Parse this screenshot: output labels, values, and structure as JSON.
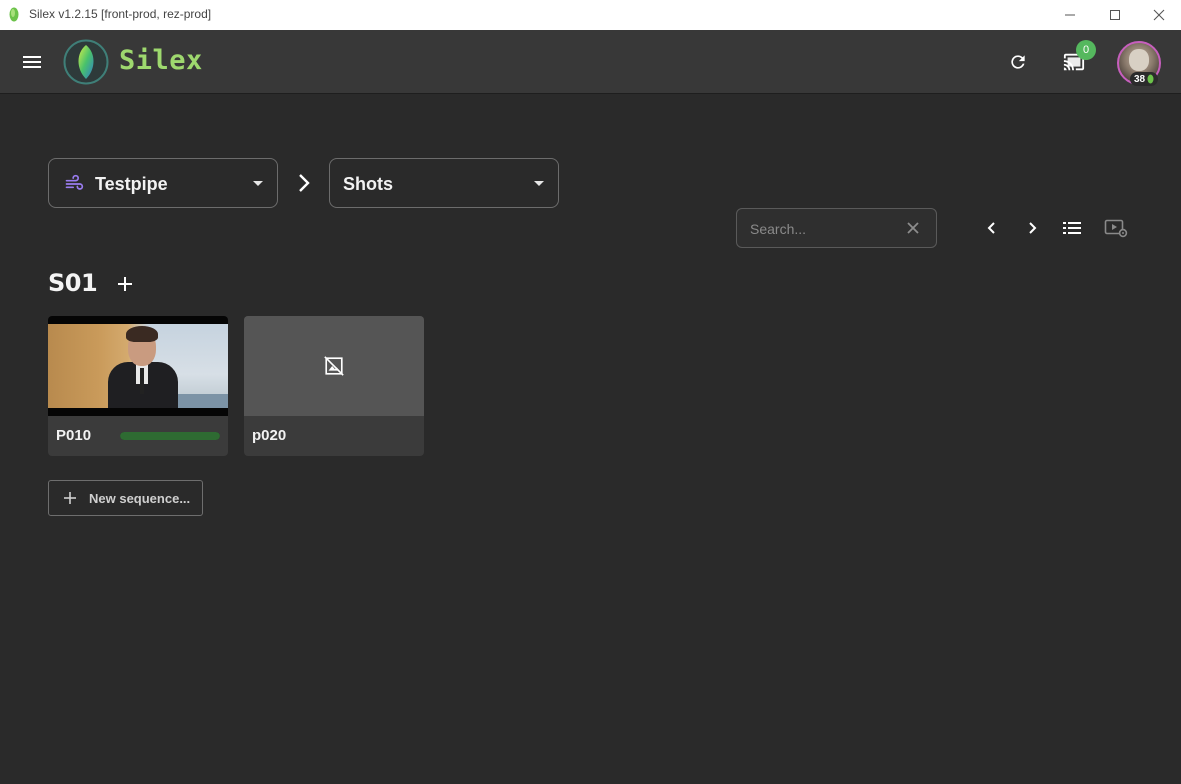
{
  "window": {
    "title": "Silex v1.2.15 [front-prod, rez-prod]"
  },
  "appbar": {
    "brand": "Silex",
    "cast_badge": "0",
    "avatar_level": "38",
    "colors": {
      "brand": "#9ed86e",
      "badge": "#55b85e",
      "avatar_ring": "#c75fbe"
    }
  },
  "selectors": {
    "project": {
      "label": "Testpipe",
      "icon": "wind-icon"
    },
    "category": {
      "label": "Shots"
    }
  },
  "search": {
    "placeholder": "Search...",
    "value": ""
  },
  "sequence": {
    "title": "S01",
    "shots": [
      {
        "name": "P010",
        "has_thumbnail": true,
        "progress": 1.0
      },
      {
        "name": "p020",
        "has_thumbnail": false
      }
    ]
  },
  "new_sequence_label": "New sequence..."
}
